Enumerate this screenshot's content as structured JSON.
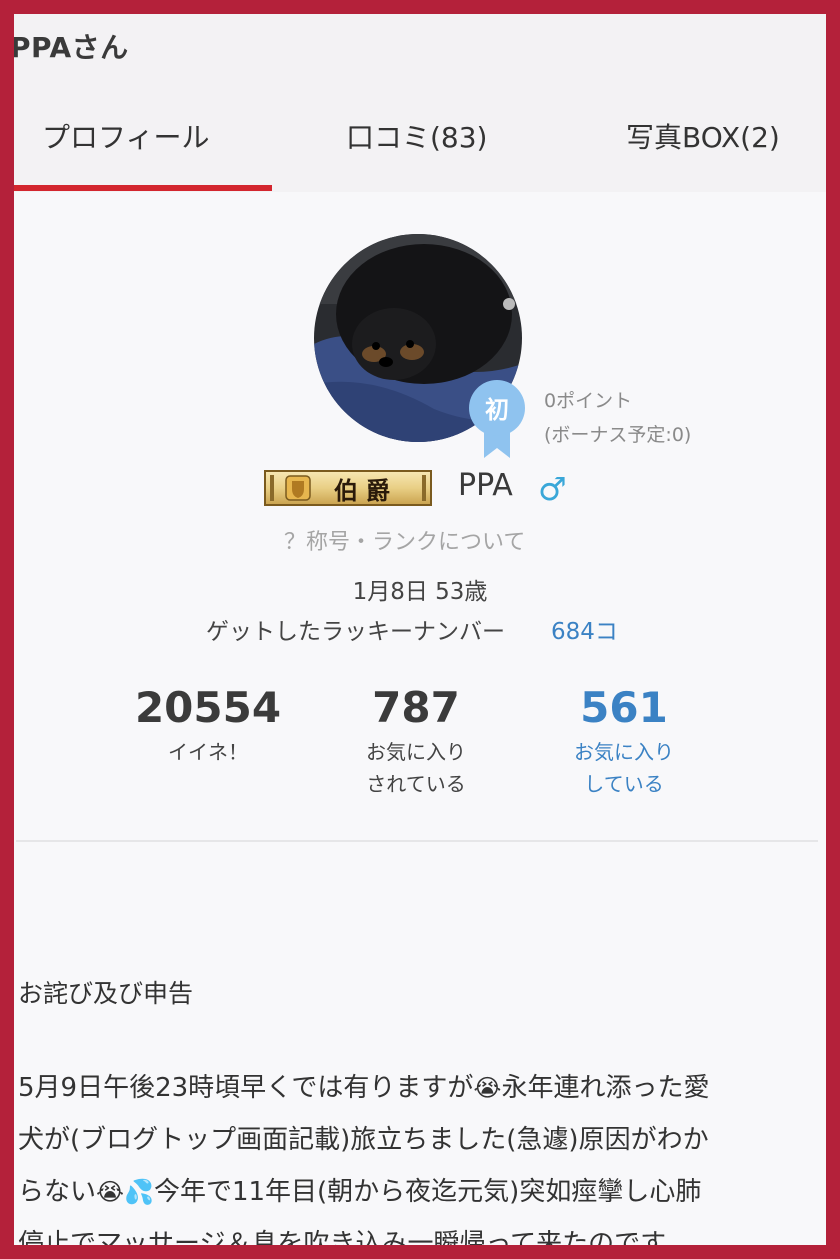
{
  "header": {
    "title": "PPAさん",
    "tabs": [
      {
        "label": "プロフィール",
        "active": true
      },
      {
        "label": "口コミ(83)"
      },
      {
        "label": "写真BOX(2)"
      }
    ],
    "accent_color": "#d3262e"
  },
  "profile": {
    "badge_char": "初",
    "points": "0ポイント",
    "bonus": "(ボーナス予定:0)",
    "rank_title": "伯爵",
    "username": "PPA",
    "gender_symbol": "♂",
    "rank_link": "？称号・ランクについて",
    "birth_age": "1月8日 53歳",
    "lucky_label": "ゲットしたラッキーナンバー",
    "lucky_value": "684コ"
  },
  "stats": [
    {
      "value": "20554",
      "label_line1": "イイネ！",
      "label_line2": ""
    },
    {
      "value": "787",
      "label_line1": "お気に入り",
      "label_line2": "されている"
    },
    {
      "value": "561",
      "label_line1": "お気に入り",
      "label_line2": "している",
      "color": "#3b82c4"
    }
  ],
  "post": {
    "heading": "お詫び及び申告",
    "line1_a": "5月9日午後23時頃早くでは有りますが",
    "line1_emoji": "😭",
    "line1_b": "永年連れ添った愛",
    "line2": "犬が(ブログトップ画面記載)旅立ちました(急遽)原因がわか",
    "line3_a": "らない",
    "line3_emoji1": "😭",
    "line3_emoji2": "💦",
    "line3_b": "今年で11年目(朝から夜迄元気)突如痙攣し心肺",
    "line4": "停止でマッサージ＆息を吹き込み一瞬帰って来たのです"
  }
}
